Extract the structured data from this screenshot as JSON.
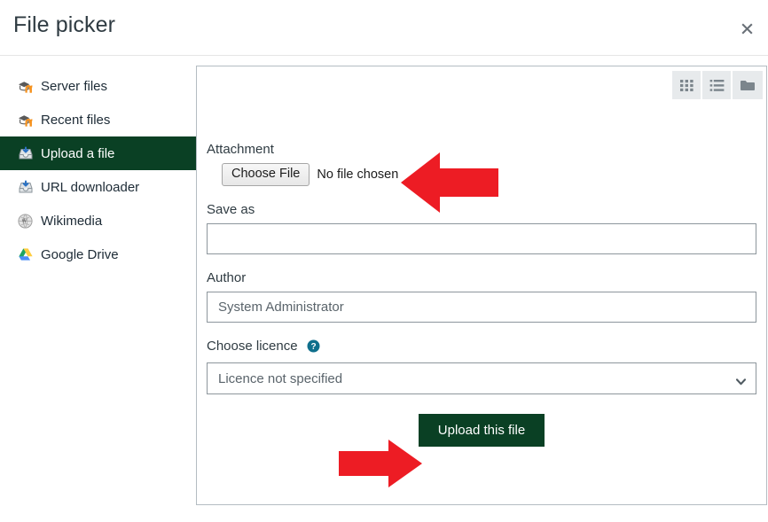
{
  "header": {
    "title": "File picker",
    "close_label": "×",
    "close_icon": "close-icon"
  },
  "sidebar": {
    "items": [
      {
        "label": "Server files",
        "icon": "moodle-logo-icon",
        "active": false
      },
      {
        "label": "Recent files",
        "icon": "moodle-logo-icon",
        "active": false
      },
      {
        "label": "Upload a file",
        "icon": "upload-tray-icon",
        "active": true
      },
      {
        "label": "URL downloader",
        "icon": "download-tray-icon",
        "active": false
      },
      {
        "label": "Wikimedia",
        "icon": "wikipedia-globe-icon",
        "active": false
      },
      {
        "label": "Google Drive",
        "icon": "google-drive-icon",
        "active": false
      }
    ],
    "active_bg": "#0a4024"
  },
  "panel": {
    "view_toolbar": [
      {
        "name": "grid-view-button",
        "icon": "grid-icon"
      },
      {
        "name": "list-view-button",
        "icon": "list-icon"
      },
      {
        "name": "tree-view-button",
        "icon": "folder-icon"
      }
    ]
  },
  "form": {
    "attachment": {
      "label": "Attachment",
      "button_label": "Choose File",
      "status_text": "No file chosen"
    },
    "save_as": {
      "label": "Save as",
      "value": "",
      "placeholder": ""
    },
    "author": {
      "label": "Author",
      "value": "System Administrator",
      "placeholder": "System Administrator"
    },
    "licence": {
      "label": "Choose licence",
      "help_icon": "help-circle-icon",
      "selected": "Licence not specified",
      "options": [
        "Licence not specified"
      ]
    },
    "submit": {
      "label": "Upload this file",
      "color": "#0a4024"
    }
  },
  "annotations": {
    "arrow_color": "#ed1c24",
    "arrows": [
      {
        "name": "arrow-pointing-to-choose-file",
        "direction": "left"
      },
      {
        "name": "arrow-pointing-to-upload-button",
        "direction": "right"
      }
    ]
  }
}
